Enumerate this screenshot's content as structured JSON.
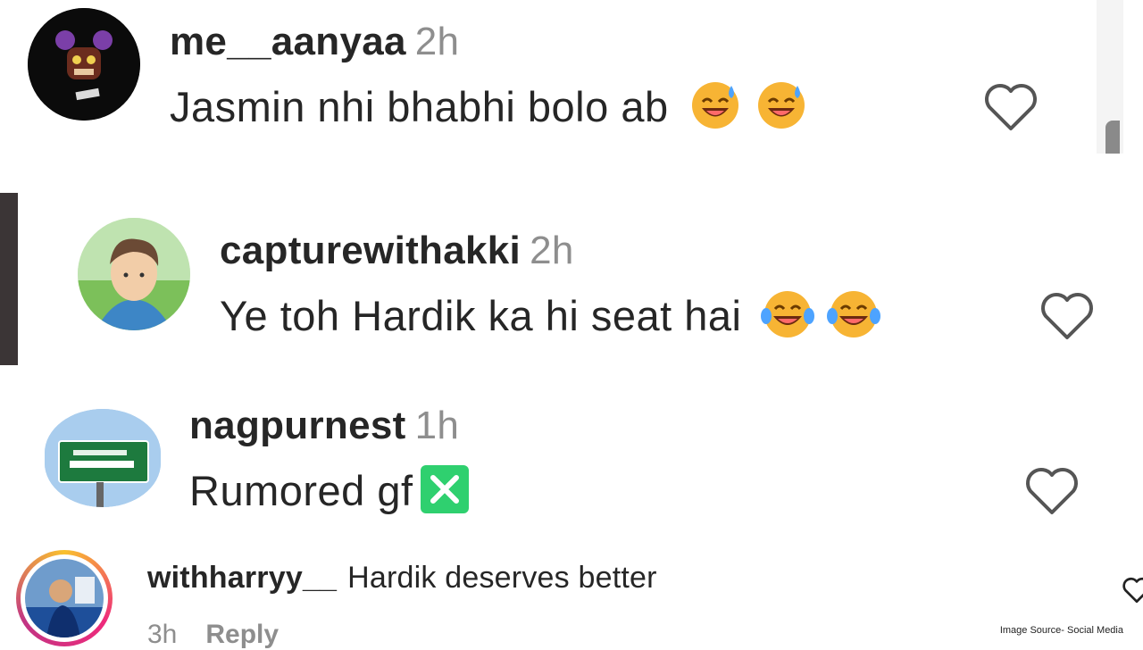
{
  "comments": [
    {
      "username": "me__aanyaa",
      "time": "2h",
      "text": "Jasmin nhi bhabhi bolo ab",
      "emojis": [
        "sweat-smile-emoji",
        "sweat-smile-emoji"
      ],
      "icon": "heart-icon"
    },
    {
      "username": "capturewithakki",
      "time": "2h",
      "text": "Ye toh Hardik ka hi seat hai",
      "emojis": [
        "tears-of-joy-emoji",
        "tears-of-joy-emoji"
      ],
      "icon": "heart-icon"
    },
    {
      "username": "nagpurnest",
      "time": "1h",
      "text": "Rumored gf",
      "emojis": [
        "cross-mark-button-emoji"
      ],
      "icon": "heart-icon"
    },
    {
      "username": "withharryy__",
      "text": "Hardik deserves better",
      "time": "3h",
      "reply_label": "Reply",
      "icon": "heart-icon"
    }
  ],
  "credit": "Image Source- Social Media",
  "colors": {
    "text": "#262626",
    "muted": "#8e8e8e",
    "emoji_face": "#f7b434",
    "cross_green": "#2fd06f"
  }
}
